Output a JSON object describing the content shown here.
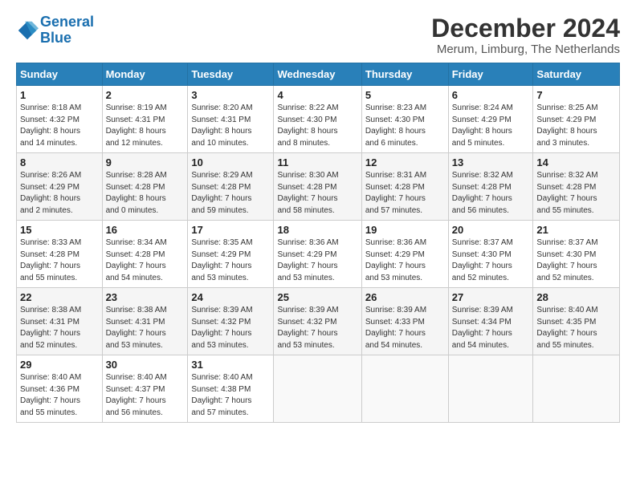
{
  "logo": {
    "line1": "General",
    "line2": "Blue"
  },
  "title": "December 2024",
  "subtitle": "Merum, Limburg, The Netherlands",
  "days_of_week": [
    "Sunday",
    "Monday",
    "Tuesday",
    "Wednesday",
    "Thursday",
    "Friday",
    "Saturday"
  ],
  "weeks": [
    [
      {
        "day": "1",
        "info": "Sunrise: 8:18 AM\nSunset: 4:32 PM\nDaylight: 8 hours\nand 14 minutes."
      },
      {
        "day": "2",
        "info": "Sunrise: 8:19 AM\nSunset: 4:31 PM\nDaylight: 8 hours\nand 12 minutes."
      },
      {
        "day": "3",
        "info": "Sunrise: 8:20 AM\nSunset: 4:31 PM\nDaylight: 8 hours\nand 10 minutes."
      },
      {
        "day": "4",
        "info": "Sunrise: 8:22 AM\nSunset: 4:30 PM\nDaylight: 8 hours\nand 8 minutes."
      },
      {
        "day": "5",
        "info": "Sunrise: 8:23 AM\nSunset: 4:30 PM\nDaylight: 8 hours\nand 6 minutes."
      },
      {
        "day": "6",
        "info": "Sunrise: 8:24 AM\nSunset: 4:29 PM\nDaylight: 8 hours\nand 5 minutes."
      },
      {
        "day": "7",
        "info": "Sunrise: 8:25 AM\nSunset: 4:29 PM\nDaylight: 8 hours\nand 3 minutes."
      }
    ],
    [
      {
        "day": "8",
        "info": "Sunrise: 8:26 AM\nSunset: 4:29 PM\nDaylight: 8 hours\nand 2 minutes."
      },
      {
        "day": "9",
        "info": "Sunrise: 8:28 AM\nSunset: 4:28 PM\nDaylight: 8 hours\nand 0 minutes."
      },
      {
        "day": "10",
        "info": "Sunrise: 8:29 AM\nSunset: 4:28 PM\nDaylight: 7 hours\nand 59 minutes."
      },
      {
        "day": "11",
        "info": "Sunrise: 8:30 AM\nSunset: 4:28 PM\nDaylight: 7 hours\nand 58 minutes."
      },
      {
        "day": "12",
        "info": "Sunrise: 8:31 AM\nSunset: 4:28 PM\nDaylight: 7 hours\nand 57 minutes."
      },
      {
        "day": "13",
        "info": "Sunrise: 8:32 AM\nSunset: 4:28 PM\nDaylight: 7 hours\nand 56 minutes."
      },
      {
        "day": "14",
        "info": "Sunrise: 8:32 AM\nSunset: 4:28 PM\nDaylight: 7 hours\nand 55 minutes."
      }
    ],
    [
      {
        "day": "15",
        "info": "Sunrise: 8:33 AM\nSunset: 4:28 PM\nDaylight: 7 hours\nand 55 minutes."
      },
      {
        "day": "16",
        "info": "Sunrise: 8:34 AM\nSunset: 4:28 PM\nDaylight: 7 hours\nand 54 minutes."
      },
      {
        "day": "17",
        "info": "Sunrise: 8:35 AM\nSunset: 4:29 PM\nDaylight: 7 hours\nand 53 minutes."
      },
      {
        "day": "18",
        "info": "Sunrise: 8:36 AM\nSunset: 4:29 PM\nDaylight: 7 hours\nand 53 minutes."
      },
      {
        "day": "19",
        "info": "Sunrise: 8:36 AM\nSunset: 4:29 PM\nDaylight: 7 hours\nand 53 minutes."
      },
      {
        "day": "20",
        "info": "Sunrise: 8:37 AM\nSunset: 4:30 PM\nDaylight: 7 hours\nand 52 minutes."
      },
      {
        "day": "21",
        "info": "Sunrise: 8:37 AM\nSunset: 4:30 PM\nDaylight: 7 hours\nand 52 minutes."
      }
    ],
    [
      {
        "day": "22",
        "info": "Sunrise: 8:38 AM\nSunset: 4:31 PM\nDaylight: 7 hours\nand 52 minutes."
      },
      {
        "day": "23",
        "info": "Sunrise: 8:38 AM\nSunset: 4:31 PM\nDaylight: 7 hours\nand 53 minutes."
      },
      {
        "day": "24",
        "info": "Sunrise: 8:39 AM\nSunset: 4:32 PM\nDaylight: 7 hours\nand 53 minutes."
      },
      {
        "day": "25",
        "info": "Sunrise: 8:39 AM\nSunset: 4:32 PM\nDaylight: 7 hours\nand 53 minutes."
      },
      {
        "day": "26",
        "info": "Sunrise: 8:39 AM\nSunset: 4:33 PM\nDaylight: 7 hours\nand 54 minutes."
      },
      {
        "day": "27",
        "info": "Sunrise: 8:39 AM\nSunset: 4:34 PM\nDaylight: 7 hours\nand 54 minutes."
      },
      {
        "day": "28",
        "info": "Sunrise: 8:40 AM\nSunset: 4:35 PM\nDaylight: 7 hours\nand 55 minutes."
      }
    ],
    [
      {
        "day": "29",
        "info": "Sunrise: 8:40 AM\nSunset: 4:36 PM\nDaylight: 7 hours\nand 55 minutes."
      },
      {
        "day": "30",
        "info": "Sunrise: 8:40 AM\nSunset: 4:37 PM\nDaylight: 7 hours\nand 56 minutes."
      },
      {
        "day": "31",
        "info": "Sunrise: 8:40 AM\nSunset: 4:38 PM\nDaylight: 7 hours\nand 57 minutes."
      },
      {
        "day": "",
        "info": ""
      },
      {
        "day": "",
        "info": ""
      },
      {
        "day": "",
        "info": ""
      },
      {
        "day": "",
        "info": ""
      }
    ]
  ]
}
